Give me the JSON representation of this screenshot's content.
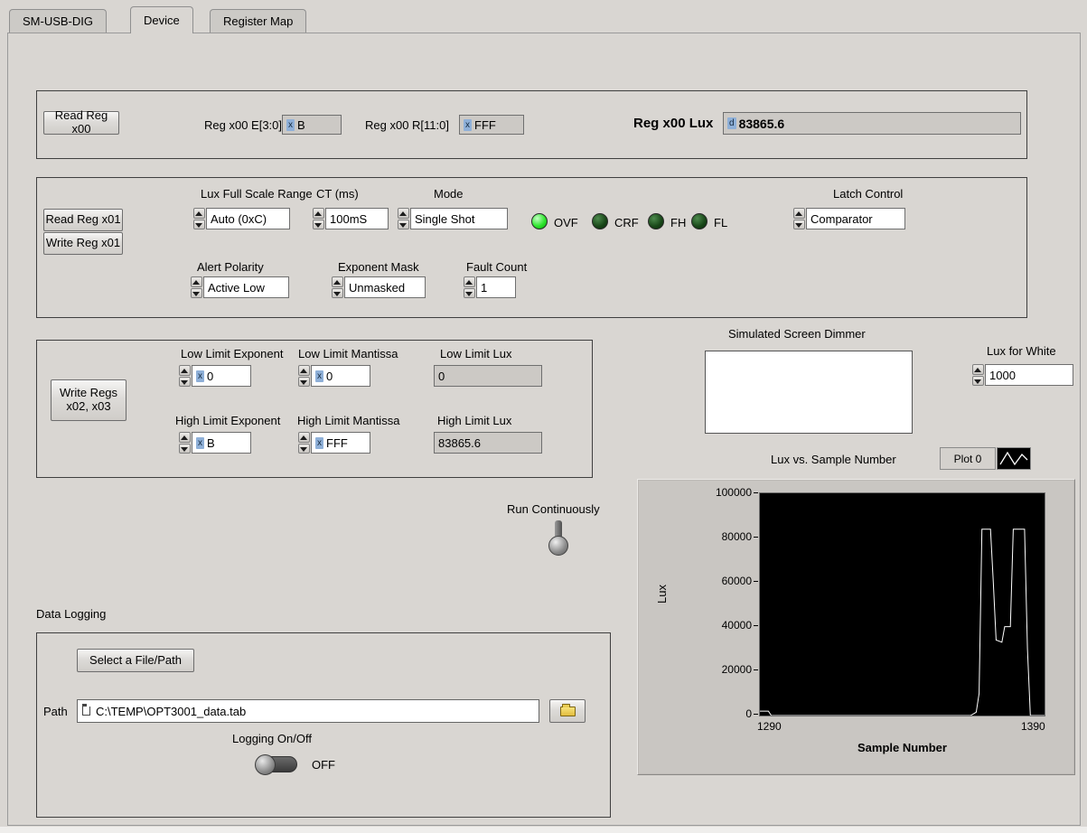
{
  "window": {
    "tabs": [
      {
        "label": "SM-USB-DIG"
      },
      {
        "label": "Device"
      },
      {
        "label": "Register Map"
      }
    ]
  },
  "reg00": {
    "read_button": "Read Reg x00",
    "e_label": "Reg x00 E[3:0]",
    "e_radix": "x",
    "e_value": "B",
    "r_label": "Reg x00 R[11:0]",
    "r_radix": "x",
    "r_value": "FFF",
    "lux_label": "Reg x00 Lux",
    "lux_radix": "d",
    "lux_value": "83865.6"
  },
  "reg01": {
    "read_button": "Read Reg x01",
    "write_button": "Write Reg x01",
    "full_scale": {
      "label": "Lux Full Scale Range",
      "value": "Auto (0xC)"
    },
    "ct": {
      "label": "CT (ms)",
      "value": "100mS"
    },
    "mode": {
      "label": "Mode",
      "value": "Single Shot"
    },
    "leds": [
      {
        "label": "OVF",
        "on": true
      },
      {
        "label": "CRF",
        "on": false
      },
      {
        "label": "FH",
        "on": false
      },
      {
        "label": "FL",
        "on": false
      }
    ],
    "latch": {
      "label": "Latch Control",
      "value": "Comparator"
    },
    "alert_polarity": {
      "label": "Alert Polarity",
      "value": "Active Low"
    },
    "exponent_mask": {
      "label": "Exponent Mask",
      "value": "Unmasked"
    },
    "fault_count": {
      "label": "Fault Count",
      "value": "1"
    }
  },
  "limits": {
    "write_button": "Write Regs x02, x03",
    "low_exponent": {
      "label": "Low Limit Exponent",
      "radix": "x",
      "value": "0"
    },
    "low_mantissa": {
      "label": "Low Limit Mantissa",
      "radix": "x",
      "value": "0"
    },
    "low_lux": {
      "label": "Low Limit Lux",
      "value": "0"
    },
    "high_exponent": {
      "label": "High Limit Exponent",
      "radix": "x",
      "value": "B"
    },
    "high_mantissa": {
      "label": "High Limit Mantissa",
      "radix": "x",
      "value": "FFF"
    },
    "high_lux": {
      "label": "High Limit Lux",
      "value": "83865.6"
    }
  },
  "dimmer": {
    "label": "Simulated Screen Dimmer"
  },
  "lux_for_white": {
    "label": "Lux for White",
    "value": "1000"
  },
  "run_continuously": {
    "label": "Run Continuously"
  },
  "chart": {
    "title": "Lux vs. Sample Number",
    "legend": "Plot 0",
    "ylabel": "Lux",
    "xlabel": "Sample Number",
    "yticks": [
      "100000",
      "80000",
      "60000",
      "40000",
      "20000",
      "0"
    ],
    "xticks": [
      "1290",
      "1390"
    ]
  },
  "chart_data": {
    "type": "line",
    "title": "Lux vs. Sample Number",
    "xlabel": "Sample Number",
    "ylabel": "Lux",
    "xlim": [
      1290,
      1390
    ],
    "ylim": [
      0,
      100000
    ],
    "legend_position": "top-right",
    "grid": false,
    "series": [
      {
        "name": "Plot 0",
        "color": "#ffffff",
        "points": [
          [
            1290,
            2000
          ],
          [
            1293,
            2000
          ],
          [
            1294,
            0
          ],
          [
            1364,
            0
          ],
          [
            1366,
            1500
          ],
          [
            1367,
            10000
          ],
          [
            1368,
            83865
          ],
          [
            1371,
            83865
          ],
          [
            1372,
            60000
          ],
          [
            1373,
            34000
          ],
          [
            1375,
            33000
          ],
          [
            1376,
            40000
          ],
          [
            1378,
            40000
          ],
          [
            1379,
            83865
          ],
          [
            1383,
            83865
          ],
          [
            1384,
            30000
          ],
          [
            1385,
            0
          ],
          [
            1390,
            0
          ]
        ]
      }
    ]
  },
  "data_logging": {
    "title": "Data Logging",
    "select_button": "Select a File/Path",
    "path_label": "Path",
    "path_value": "C:\\TEMP\\OPT3001_data.tab",
    "logging_label": "Logging On/Off",
    "logging_state": "OFF"
  }
}
